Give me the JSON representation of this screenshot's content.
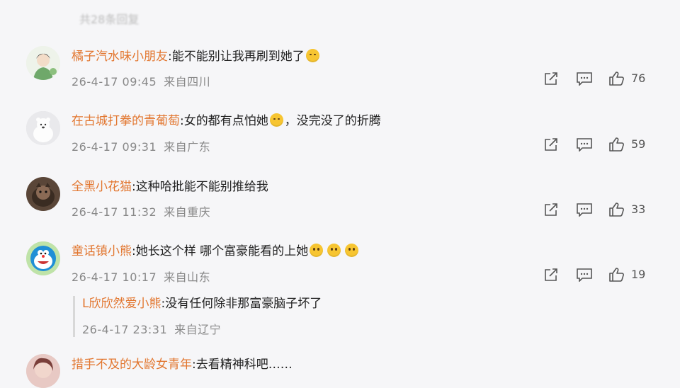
{
  "top_partial_text": "共28条回复",
  "comments": [
    {
      "user": "橘子汽水味小朋友",
      "sep": ":",
      "text": "能不能别让我再刷到她了",
      "emoji": "laugh",
      "date": "26-4-17 09:45",
      "location": "来自四川",
      "likes": "76"
    },
    {
      "user": "在古城打拳的青葡萄",
      "sep": ":",
      "text_a": "女的都有点怕她",
      "text_b": "，没完没了的折腾",
      "emoji": "laugh",
      "date": "26-4-17 09:31",
      "location": "来自广东",
      "likes": "59"
    },
    {
      "user": "全黑小花猫",
      "sep": ":",
      "text": "这种哈批能不能别推给我",
      "date": "26-4-17 11:32",
      "location": "来自重庆",
      "likes": "33"
    },
    {
      "user": "童话镇小熊",
      "sep": ":",
      "text": "她长这个样 哪个富豪能看的上她",
      "emoji_count": 3,
      "date": "26-4-17 10:17",
      "location": "来自山东",
      "likes": "19"
    },
    {
      "user": "措手不及的大龄女青年",
      "sep": ":",
      "text": "去看精神科吧……"
    }
  ],
  "reply": {
    "user": "L欣欣然爱小熊",
    "sep": ":",
    "text": "没有任何除非那富豪脑子坏了",
    "date": "26-4-17 23:31",
    "location": "来自辽宁"
  },
  "icons": [
    "share-icon",
    "comment-icon",
    "like-icon"
  ],
  "colors": {
    "username": "#e2762f",
    "meta": "#888888",
    "background": "#f6f6f8"
  }
}
